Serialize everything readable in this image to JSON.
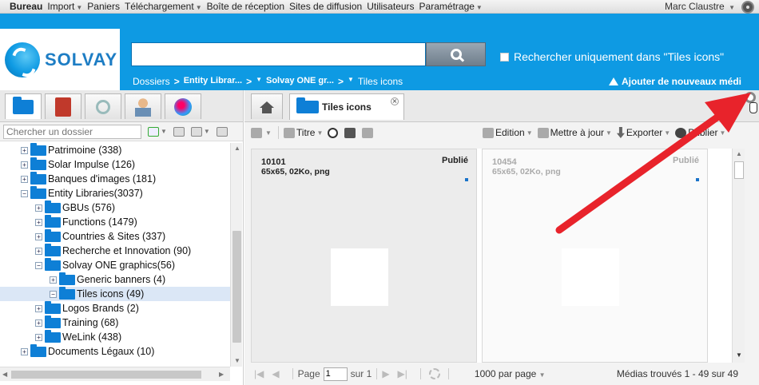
{
  "topbar": {
    "items": [
      {
        "label": "Bureau",
        "bold": true,
        "caret": false
      },
      {
        "label": "Import",
        "bold": false,
        "caret": true
      },
      {
        "label": "Paniers",
        "bold": false,
        "caret": false
      },
      {
        "label": "Téléchargement",
        "bold": false,
        "caret": true
      },
      {
        "label": "Boîte de réception",
        "bold": false,
        "caret": false
      },
      {
        "label": "Sites de diffusion",
        "bold": false,
        "caret": false
      },
      {
        "label": "Utilisateurs",
        "bold": false,
        "caret": false
      },
      {
        "label": "Paramétrage",
        "bold": false,
        "caret": true
      }
    ],
    "user": "Marc Claustre"
  },
  "header": {
    "logo_text": "SOLVAY",
    "search_value": "",
    "only_search_label": "Rechercher uniquement dans \"Tiles icons\"",
    "breadcrumb": {
      "root": "Dossiers",
      "level1": "Entity Librar...",
      "level2": "Solvay ONE gr...",
      "current": "Tiles icons"
    },
    "add_new_label": "Ajouter de nouveaux médi"
  },
  "left": {
    "folder_search_placeholder": "Chercher un dossier",
    "tree": [
      {
        "label": "Patrimoine (338)",
        "indent": 0,
        "expanded": false,
        "selected": false
      },
      {
        "label": "Solar Impulse (126)",
        "indent": 0,
        "expanded": false,
        "selected": false
      },
      {
        "label": "Banques d'images (181)",
        "indent": 0,
        "expanded": false,
        "selected": false
      },
      {
        "label": "Entity Libraries(3037)",
        "indent": 0,
        "expanded": true,
        "selected": false
      },
      {
        "label": "GBUs (576)",
        "indent": 1,
        "expanded": false,
        "selected": false
      },
      {
        "label": "Functions (1479)",
        "indent": 1,
        "expanded": false,
        "selected": false
      },
      {
        "label": "Countries & Sites (337)",
        "indent": 1,
        "expanded": false,
        "selected": false
      },
      {
        "label": "Recherche et Innovation (90)",
        "indent": 1,
        "expanded": false,
        "selected": false
      },
      {
        "label": "Solvay ONE graphics(56)",
        "indent": 1,
        "expanded": true,
        "selected": false
      },
      {
        "label": "Generic banners (4)",
        "indent": 2,
        "expanded": false,
        "selected": false
      },
      {
        "label": "Tiles icons (49)",
        "indent": 2,
        "expanded": true,
        "selected": true
      },
      {
        "label": "Logos Brands (2)",
        "indent": 1,
        "expanded": false,
        "selected": false
      },
      {
        "label": "Training (68)",
        "indent": 1,
        "expanded": false,
        "selected": false
      },
      {
        "label": "WeLink (438)",
        "indent": 1,
        "expanded": false,
        "selected": false
      },
      {
        "label": "Documents Légaux (10)",
        "indent": 0,
        "expanded": false,
        "selected": false
      }
    ]
  },
  "right": {
    "tab_label": "Tiles icons",
    "toolbar": {
      "title_label": "Titre",
      "edition_label": "Edition",
      "update_label": "Mettre à jour",
      "export_label": "Exporter",
      "publish_label": "Publier"
    },
    "cards": [
      {
        "id": "10101",
        "status": "Publié",
        "meta": "65x65, 02Ko, png"
      },
      {
        "id": "10454",
        "status": "Publié",
        "meta": "65x65, 02Ko, png"
      }
    ],
    "pager": {
      "page_label": "Page",
      "page_value": "1",
      "of_label": "sur 1",
      "per_page": "1000 par page",
      "found": "Médias trouvés 1 - 49 sur 49"
    }
  },
  "colors": {
    "brand_blue": "#0e9ae3",
    "folder_blue": "#0e7fd6",
    "annotation_red": "#e8232b"
  }
}
